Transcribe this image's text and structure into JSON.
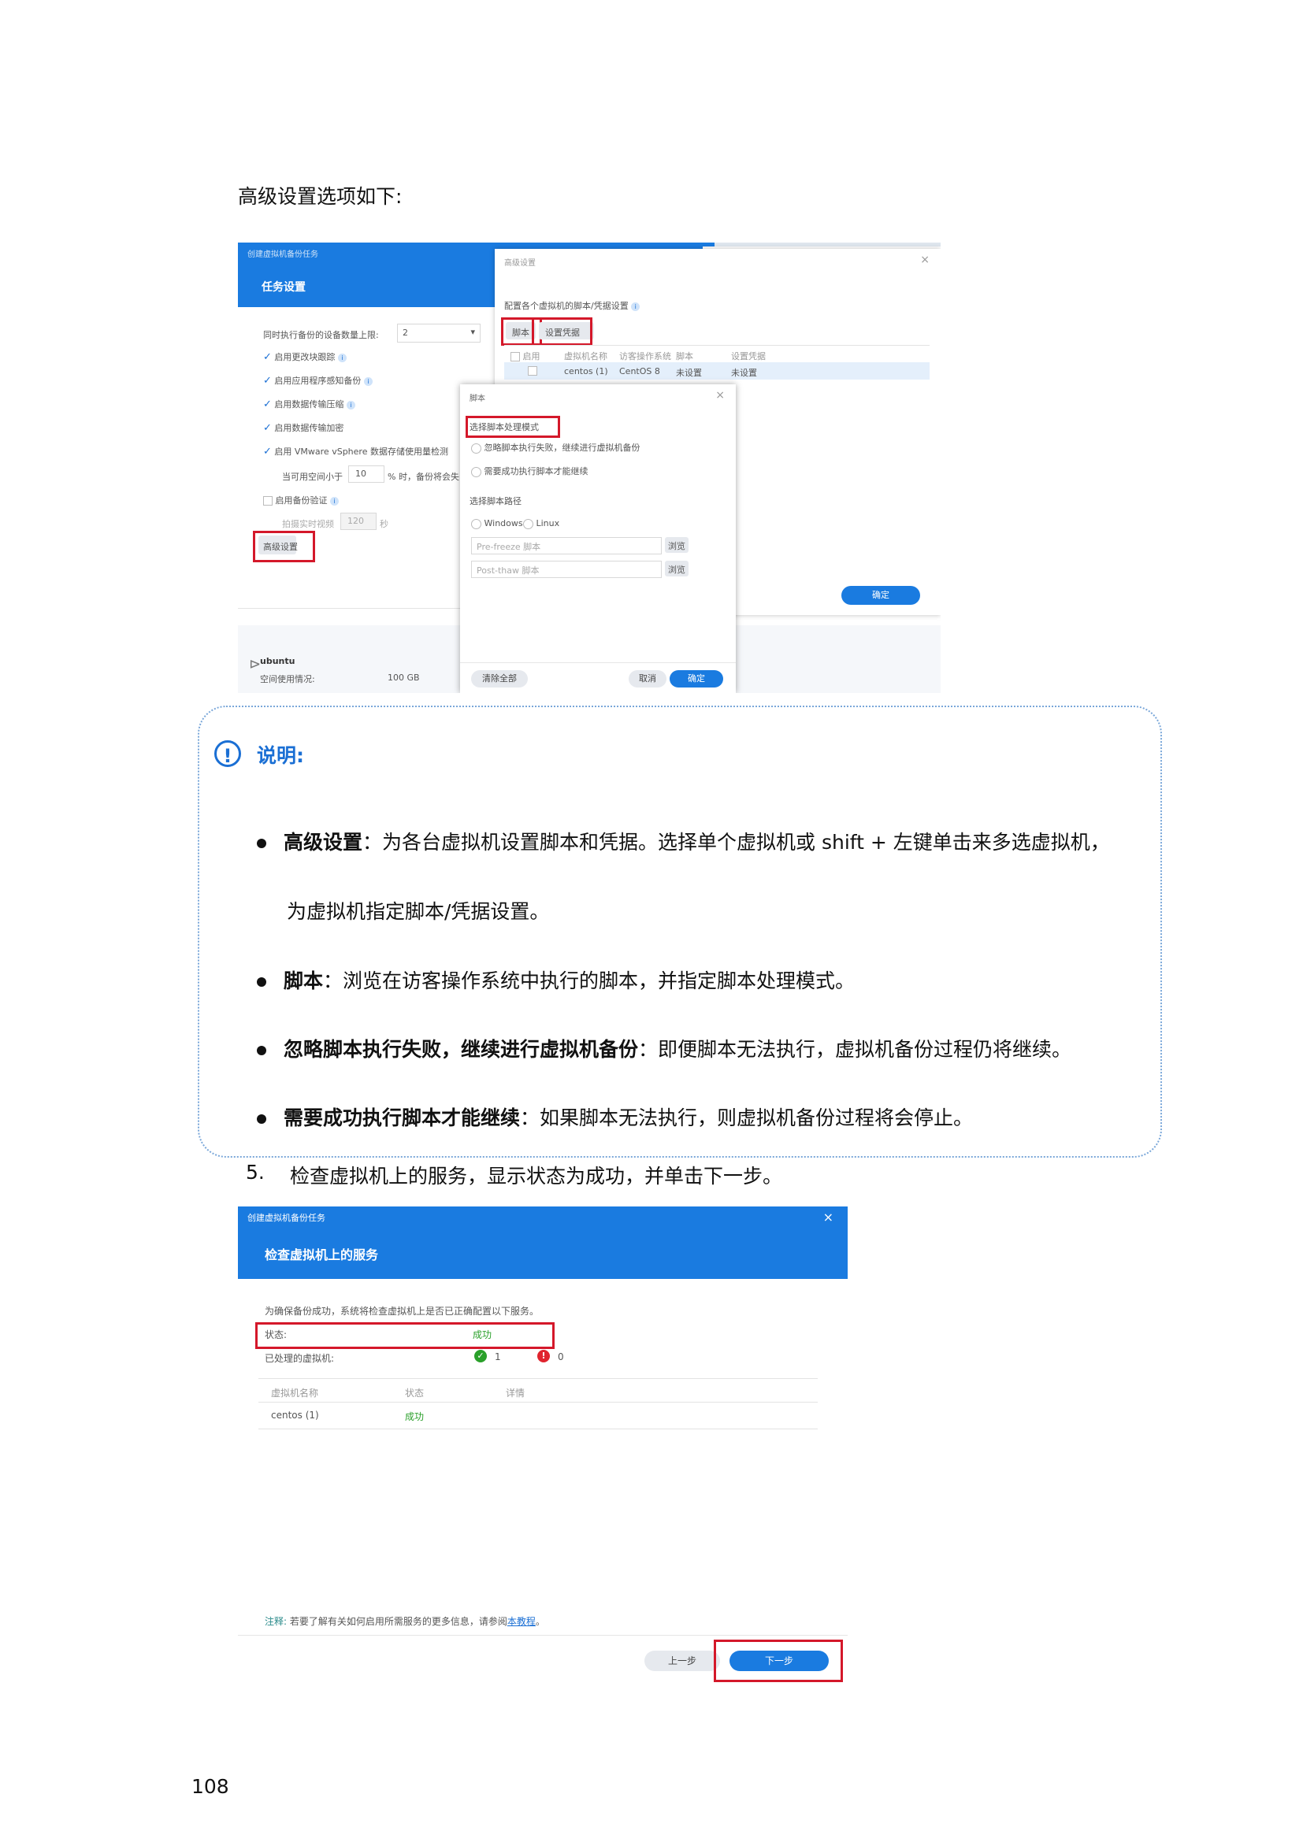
{
  "intro_text": "高级设置选项如下:",
  "shot1": {
    "window_title": "创建虚拟机备份任务",
    "header_title": "任务设置",
    "concurrent_label": "同时执行备份的设备数量上限:",
    "concurrent_value": "2",
    "checks": [
      {
        "label": "启用更改块跟踪",
        "checked": true
      },
      {
        "label": "启用应用程序感知备份",
        "checked": true
      },
      {
        "label": "启用数据传输压缩",
        "checked": true
      },
      {
        "label": "启用数据传输加密",
        "checked": true
      },
      {
        "label": "启用 VMware vSphere 数据存储使用量检测",
        "checked": true
      }
    ],
    "space_label": "当可用空间小于",
    "space_value": "10",
    "space_suffix": "% 时，备份将会失",
    "verify_label": "启用备份验证",
    "verify_sub_label": "拍摄实时视频",
    "verify_value": "120",
    "verify_unit": "秒",
    "advanced_button": "高级设置",
    "device_name": "ubuntu",
    "device_space_label": "空间使用情况:",
    "device_space_value": "100 GB",
    "adv_panel": {
      "title": "高级设置",
      "subtitle": "配置各个虚拟机的脚本/凭据设置",
      "btn_script": "脚本",
      "btn_credential": "设置凭据",
      "columns": [
        "启用",
        "虚拟机名称",
        "访客操作系统",
        "脚本",
        "设置凭据"
      ],
      "row": [
        "centos (1)",
        "CentOS 8",
        "未设置",
        "未设置"
      ],
      "confirm": "确定"
    },
    "script_dialog": {
      "title": "脚本",
      "mode_label": "选择脚本处理模式",
      "mode_options": [
        "忽略脚本执行失败，继续进行虚拟机备份",
        "需要成功执行脚本才能继续"
      ],
      "path_label": "选择脚本路径",
      "os_options": [
        "Windows",
        "Linux"
      ],
      "pre_freeze_placeholder": "Pre-freeze 脚本",
      "post_thaw_placeholder": "Post-thaw 脚本",
      "browse": "浏览",
      "clear_all": "清除全部",
      "cancel": "取消",
      "ok": "确定"
    }
  },
  "note": {
    "title": "说明:",
    "bullets": [
      {
        "bold": "高级设置",
        "text": "：为各台虚拟机设置脚本和凭据。选择单个虚拟机或 shift + 左键单击来多选虚拟机，",
        "cont": "为虚拟机指定脚本/凭据设置。"
      },
      {
        "bold": "脚本",
        "text": "：浏览在访客操作系统中执行的脚本，并指定脚本处理模式。"
      },
      {
        "bold": "忽略脚本执行失败，继续进行虚拟机备份",
        "text": "：即便脚本无法执行，虚拟机备份过程仍将继续。"
      },
      {
        "bold": "需要成功执行脚本才能继续",
        "text": "：如果脚本无法执行，则虚拟机备份过程将会停止。"
      }
    ]
  },
  "step5": {
    "number": "5.",
    "text": "检查虚拟机上的服务，显示状态为成功，并单击下一步。"
  },
  "shot2": {
    "window_title": "创建虚拟机备份任务",
    "header_title": "检查虚拟机上的服务",
    "desc": "为确保备份成功，系统将检查虚拟机上是否已正确配置以下服务。",
    "status_label": "状态:",
    "status_value": "成功",
    "processed_label": "已处理的虚拟机:",
    "ok_count": "1",
    "fail_count": "0",
    "columns": [
      "虚拟机名称",
      "状态",
      "详情"
    ],
    "row": [
      "centos (1)",
      "成功",
      ""
    ],
    "footnote_prefix": "注释:",
    "footnote_text": "若要了解有关如何启用所需服务的更多信息，请参阅",
    "footnote_link": "本教程",
    "footnote_end": "。",
    "prev_button": "上一步",
    "next_button": "下一步"
  },
  "page_number": "108",
  "colors": {
    "accent": "#1a7be0",
    "highlight": "#d4182a",
    "success": "#2aa02a",
    "error": "#e0242e"
  }
}
